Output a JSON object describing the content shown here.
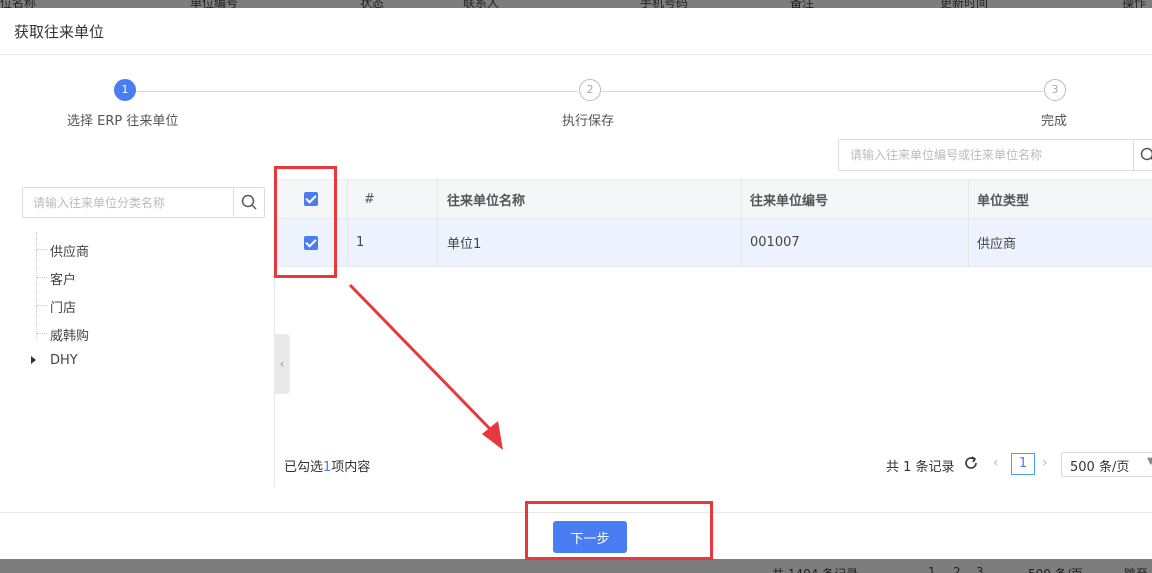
{
  "background_page": {
    "top_headers": [
      "位名称",
      "单位编号",
      "状态",
      "联系人",
      "手机号码",
      "备注",
      "更新时间",
      "操作"
    ],
    "bottom_pager": {
      "total": "共 1404 条记录",
      "pages": [
        "1",
        "2",
        "3"
      ],
      "size": "500 条/页",
      "jump": "跳至"
    }
  },
  "dialog": {
    "title": "获取往来单位",
    "steps": [
      {
        "num": "1",
        "label": "选择 ERP 往来单位",
        "active": true
      },
      {
        "num": "2",
        "label": "执行保存",
        "active": false
      },
      {
        "num": "3",
        "label": "完成",
        "active": false
      }
    ],
    "category_search_placeholder": "请输入往来单位分类名称",
    "category_tree": [
      {
        "label": "供应商"
      },
      {
        "label": "客户"
      },
      {
        "label": "门店"
      },
      {
        "label": "威韩购"
      },
      {
        "label": "DHY"
      }
    ],
    "table_search_placeholder": "请输入往来单位编号或往来单位名称",
    "table": {
      "headers": {
        "index": "#",
        "name": "往来单位名称",
        "code": "往来单位编号",
        "type": "单位类型"
      },
      "rows": [
        {
          "index": "1",
          "name": "单位1",
          "code": "001007",
          "type": "供应商",
          "checked": true
        }
      ]
    },
    "selection": {
      "prefix": "已勾选",
      "count": "1",
      "suffix": "项内容"
    },
    "pager": {
      "total": "共 1 条记录",
      "current": "1",
      "prev": "‹",
      "next": "›",
      "page_size": "500 条/页"
    },
    "next_button": "下一步"
  },
  "colors": {
    "primary": "#4a7df2",
    "annotation": "#e8383b",
    "row_selected": "#edf3fe"
  }
}
